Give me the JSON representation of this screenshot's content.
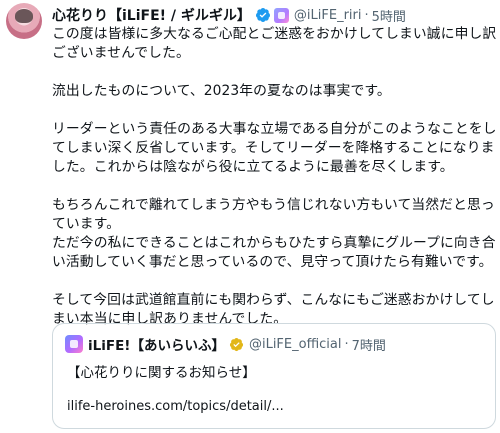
{
  "tweet": {
    "author_name": "心花りり【iLiFE! / ギルギル】",
    "handle": "@iLiFE_riri",
    "separator": "·",
    "time": "5時間",
    "paragraphs": [
      "この度は皆様に多大なるご心配とご迷惑をおかけしてしまい誠に申し訳ございませんでした。",
      "流出したものについて、2023年の夏なのは事実です。",
      "リーダーという責任のある大事な立場である自分がこのようなことをしてしまい深く反省しています。そしてリーダーを降格することになりました。これからは陰ながら役に立てるように最善を尽くします。",
      "もちろんこれで離れてしまう方やもう信じれない方もいて当然だと思っています。\nただ今の私にできることはこれからもひたすら真摯にグループに向き合い活動していく事だと思っているので、見守って頂けたら有難いです。",
      "そして今回は武道館直前にも関わらず、こんなにもご迷惑おかけしてしまい本当に申し訳ありませんでした。"
    ]
  },
  "quote": {
    "author_name": "iLiFE!【あいらいふ】",
    "handle": "@iLiFE_official",
    "separator": "·",
    "time": "7時間",
    "text": "【心花りりに関するお知らせ】",
    "link": "ilife-heroines.com/topics/detail/..."
  },
  "colors": {
    "verified_blue": "#1d9bf0",
    "verified_gold": "#e2b719",
    "secondary_text": "#536471",
    "border": "#cfd9de"
  }
}
